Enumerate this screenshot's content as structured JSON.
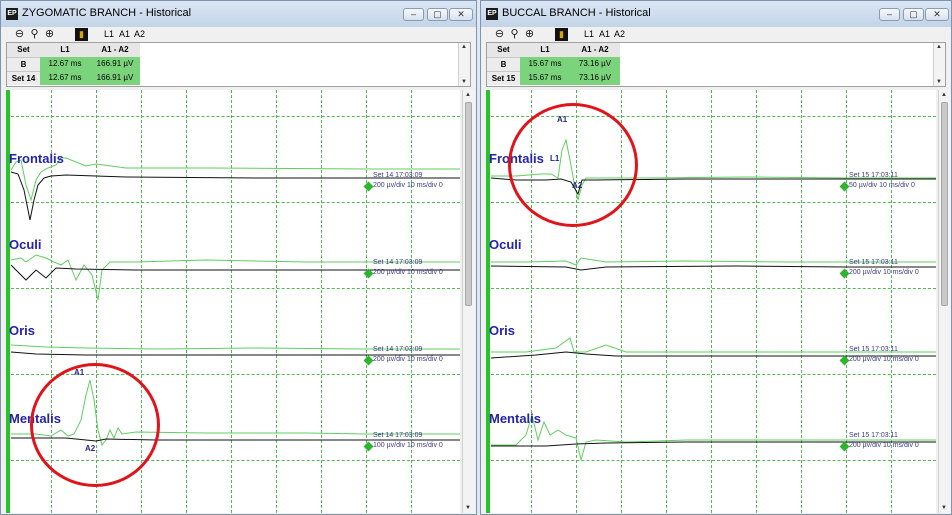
{
  "windows": [
    {
      "title": "ZYGOMATIC BRANCH - Historical",
      "toolbar": {
        "markers": [
          "L1",
          "A1",
          "A2"
        ]
      },
      "table": {
        "headers": [
          "Set",
          "L1",
          "A1 - A2"
        ],
        "rows": [
          [
            "B",
            "12.67 ms",
            "166.91 µV"
          ],
          [
            "Set 14",
            "12.67 ms",
            "166.91 µV"
          ]
        ]
      },
      "channels": [
        {
          "name": "Frontalis",
          "set": "Set 14 17:03:09",
          "scale": "200 µv/div 10 ms/div 0"
        },
        {
          "name": "Oculi",
          "set": "Set 14 17:03:09",
          "scale": "200 µv/div 10 ms/div 0"
        },
        {
          "name": "Oris",
          "set": "Set 14 17:03:09",
          "scale": "200 µv/div 10 ms/div 0"
        },
        {
          "name": "Mentalis",
          "set": "Set 14 17:03:09",
          "scale": "100 µv/div 10 ms/div 0",
          "markers": {
            "a1": "A1",
            "a2": "A2"
          }
        }
      ]
    },
    {
      "title": "BUCCAL BRANCH - Historical",
      "toolbar": {
        "markers": [
          "L1",
          "A1",
          "A2"
        ]
      },
      "table": {
        "headers": [
          "Set",
          "L1",
          "A1 - A2"
        ],
        "rows": [
          [
            "B",
            "15.67 ms",
            "73.16 µV"
          ],
          [
            "Set 15",
            "15.67 ms",
            "73.16 µV"
          ]
        ]
      },
      "channels": [
        {
          "name": "Frontalis",
          "set": "Set 15 17:03:11",
          "scale": "50 µv/div 10 ms/div 0",
          "markers": {
            "a1": "A1",
            "l1": "L1",
            "a2": "A2"
          }
        },
        {
          "name": "Oculi",
          "set": "Set 15 17:03:11",
          "scale": "200 µv/div 10 ms/div 0"
        },
        {
          "name": "Oris",
          "set": "Set 15 17:03:11",
          "scale": "200 µv/div 10 ms/div 0"
        },
        {
          "name": "Mentalis",
          "set": "Set 15 17:03:11",
          "scale": "200 µv/div 10 ms/div 0"
        }
      ]
    }
  ],
  "colors": {
    "grid": "#55b855",
    "trace_green": "#5fcf5f",
    "trace_black": "#111111",
    "label": "#2424a8",
    "highlight": "#e0141a"
  }
}
